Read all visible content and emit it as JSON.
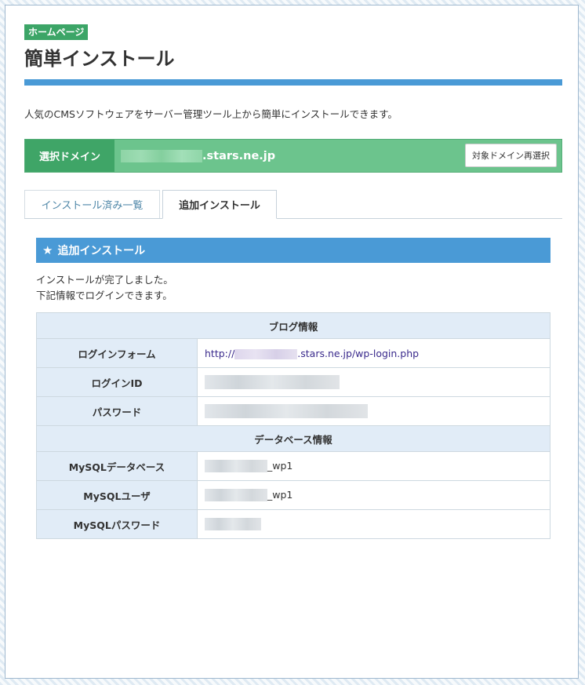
{
  "header": {
    "badge": "ホームページ",
    "title": "簡単インストール",
    "description": "人気のCMSソフトウェアをサーバー管理ツール上から簡単にインストールできます。"
  },
  "domain": {
    "label": "選択ドメイン",
    "suffix": ".stars.ne.jp",
    "reselect_button": "対象ドメイン再選択"
  },
  "tabs": [
    {
      "label": "インストール済み一覧",
      "active": false
    },
    {
      "label": "追加インストール",
      "active": true
    }
  ],
  "section": {
    "title": "追加インストール",
    "message_line1": "インストールが完了しました。",
    "message_line2": "下記情報でログインできます。"
  },
  "table": {
    "blog_header": "ブログ情報",
    "login_form_label": "ログインフォーム",
    "login_url_prefix": "http://",
    "login_url_suffix": ".stars.ne.jp/wp-login.php",
    "login_id_label": "ログインID",
    "password_label": "パスワード",
    "db_header": "データベース情報",
    "mysql_db_label": "MySQLデータベース",
    "mysql_db_suffix": "_wp1",
    "mysql_user_label": "MySQLユーザ",
    "mysql_user_suffix": "_wp1",
    "mysql_password_label": "MySQLパスワード"
  },
  "colors": {
    "accent_blue": "#4a9ad6",
    "accent_green": "#3ca567"
  }
}
